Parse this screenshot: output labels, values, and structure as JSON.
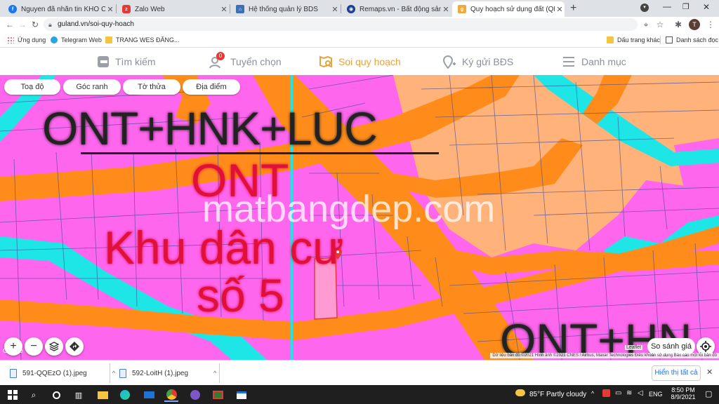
{
  "tabs": [
    {
      "title": "Nguyen đã nhắn tin KHO CHUỐI",
      "icon": "facebook-icon",
      "color": "#1877f2"
    },
    {
      "title": "Zalo Web",
      "icon": "zalo-icon",
      "color": "#e53935"
    },
    {
      "title": "Hệ thống quản lý BDS",
      "icon": "building-icon",
      "color": "#3b6fb6"
    },
    {
      "title": "Remaps.vn - Bất động sản thật",
      "icon": "remaps-icon",
      "color": "#1c3f8f"
    },
    {
      "title": "Quy hoạch sử dụng đất (QHSDĐ)",
      "icon": "guland-icon",
      "color": "#f2a93b",
      "active": true
    }
  ],
  "address": {
    "url": "guland.vn/soi-quy-hoach",
    "profile_initial": "T"
  },
  "bookmarks": {
    "items": [
      "Ứng dụng",
      "Telegram Web",
      "TRANG WES ĐĂNG..."
    ],
    "right": [
      "Dấu trang khác",
      "Danh sách đọc"
    ]
  },
  "site_nav": {
    "items": [
      "Tìm kiếm",
      "Tuyển chọn",
      "Soi quy hoạch",
      "Ký gửi BĐS",
      "Danh mục"
    ],
    "badge": "0",
    "active_index": 2
  },
  "map": {
    "chips": [
      "Toạ độ",
      "Góc ranh",
      "Tờ thửa",
      "Địa điểm"
    ],
    "labels": {
      "zone_top": "ONT+HNK+LUC",
      "zone_mid": "ONT",
      "area_line1": "Khu dân cư",
      "area_line2": "số 5",
      "watermark": "matbangdep.com",
      "zone_bottom": "ONT+HN"
    },
    "compare_button": "So sánh giá",
    "attribution": "Dữ liệu bản đồ ©2021 Hình ảnh ©2021 CNES / Airbus, Maxar Technologies   Điều khoản sử dụng   Báo cáo một lỗi bản đồ",
    "leaflet": "Leaflet",
    "google": "Google",
    "colors": {
      "residential": "#ff66ee",
      "road": "#ff8c1a",
      "water": "#1ee6e6",
      "farmland": "#ffb27a"
    }
  },
  "downloads": {
    "files": [
      "591-QQEzO (1).jpeg",
      "592-LoitH (1).jpeg"
    ],
    "show_all": "Hiển thị tất cả"
  },
  "taskbar": {
    "weather": "85°F  Partly cloudy",
    "lang": "ENG",
    "time": "8:50 PM",
    "date": "8/9/2021"
  }
}
